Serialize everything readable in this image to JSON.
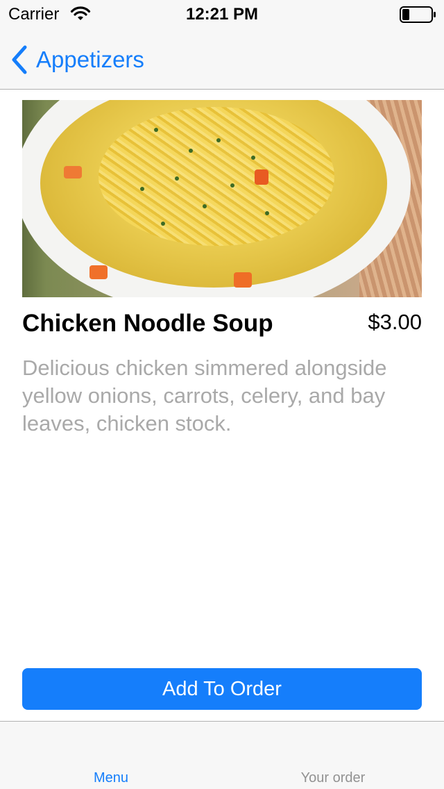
{
  "status_bar": {
    "carrier": "Carrier",
    "time": "12:21 PM",
    "icons": [
      "wifi-icon",
      "battery-icon"
    ]
  },
  "nav": {
    "back_label": "Appetizers",
    "back_icon": "chevron-left-icon"
  },
  "item": {
    "image_alt": "bowl of chicken noodle soup",
    "name": "Chicken Noodle Soup",
    "price": "$3.00",
    "description": "Delicious chicken simmered alongside yellow onions, carrots, celery, and bay leaves, chicken stock."
  },
  "actions": {
    "add_to_order_label": "Add To Order"
  },
  "tab_bar": {
    "tabs": [
      {
        "label": "Menu",
        "selected": true
      },
      {
        "label": "Your order",
        "selected": false
      }
    ]
  },
  "colors": {
    "accent": "#157efb",
    "secondary_text": "#a9a9a9",
    "bar_background": "#f7f7f7"
  }
}
